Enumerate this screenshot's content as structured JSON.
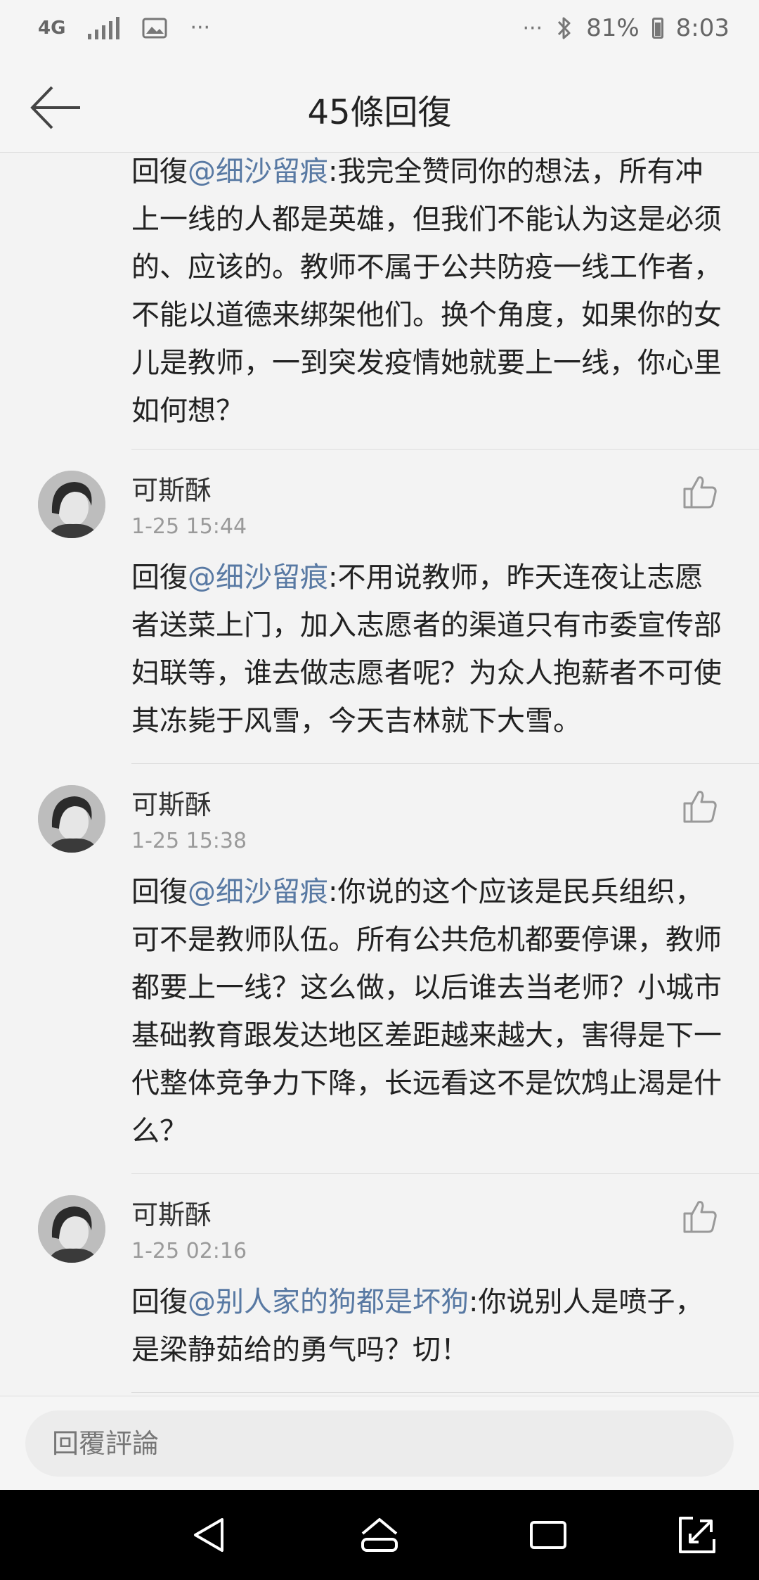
{
  "status_bar": {
    "network": "4G",
    "left_more": "···",
    "right_more": "···",
    "battery": "81%",
    "time": "8:03",
    "icons": [
      "signal-icon",
      "image-icon",
      "bluetooth-icon",
      "battery-icon"
    ]
  },
  "header": {
    "title": "45條回復",
    "back_icon": "arrow-left-icon"
  },
  "comments": [
    {
      "username": "",
      "timestamp": "",
      "prefix": "回復",
      "mention": "@细沙留痕",
      "text": ":我完全赞同你的想法，所有冲上一线的人都是英雄，但我们不能认为这是必须的、应该的。教师不属于公共防疫一线工作者，不能以道德来绑架他们。换个角度，如果你的女儿是教师，一到突发疫情她就要上一线，你心里如何想？"
    },
    {
      "username": "可斯酥",
      "timestamp": "1-25 15:44",
      "prefix": "回復",
      "mention": "@细沙留痕",
      "text": ":不用说教师，昨天连夜让志愿者送菜上门，加入志愿者的渠道只有市委宣传部妇联等，谁去做志愿者呢？为众人抱薪者不可使其冻毙于风雪，今天吉林就下大雪。"
    },
    {
      "username": "可斯酥",
      "timestamp": "1-25 15:38",
      "prefix": "回復",
      "mention": "@细沙留痕",
      "text": ":你说的这个应该是民兵组织，可不是教师队伍。所有公共危机都要停课，教师都要上一线？这么做，以后谁去当老师？小城市基础教育跟发达地区差距越来越大，害得是下一代整体竞争力下降，长远看这不是饮鸩止渴是什么？"
    },
    {
      "username": "可斯酥",
      "timestamp": "1-25 02:16",
      "prefix": "回復",
      "mention": "@别人家的狗都是坏狗",
      "text": ":你说别人是喷子，是梁静茹给的勇气吗？切！"
    }
  ],
  "reply_bar": {
    "placeholder": "回覆評論"
  },
  "nav_bar": {
    "icons": [
      "back-triangle-icon",
      "home-icon",
      "recents-icon",
      "rotate-icon"
    ]
  },
  "colors": {
    "mention": "#5879a3",
    "background": "#f3f3f3",
    "nav_bar": "#000000"
  }
}
